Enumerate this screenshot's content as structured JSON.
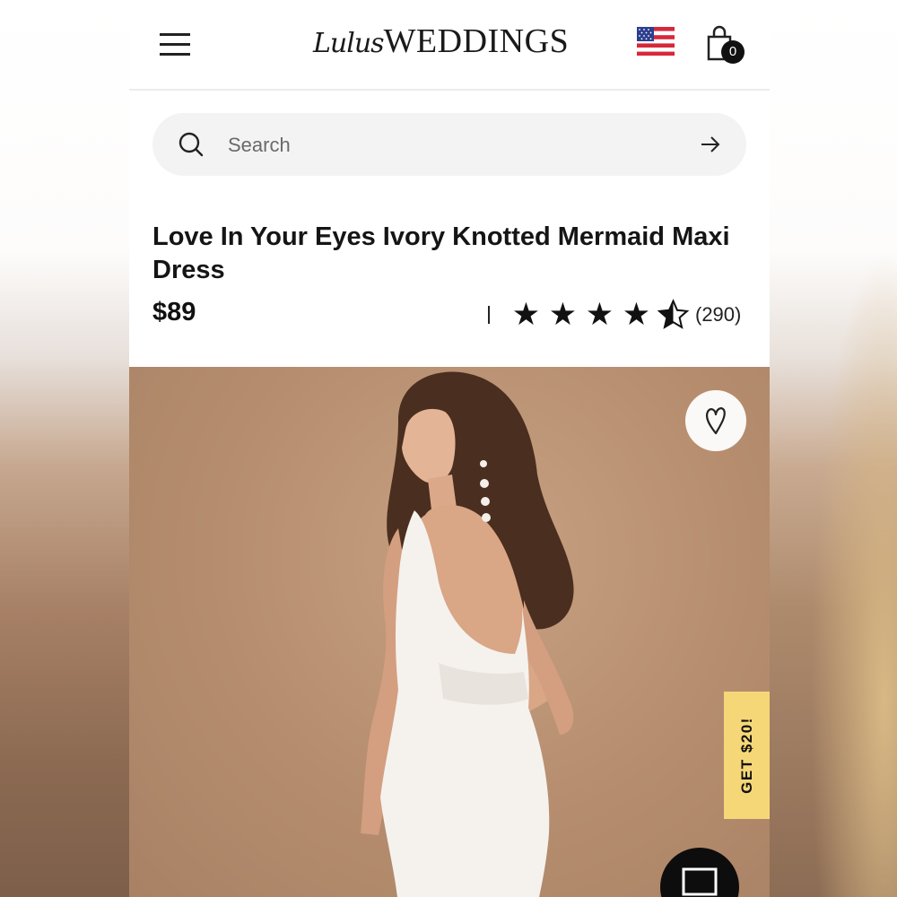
{
  "header": {
    "menu_icon": "hamburger-menu-icon",
    "logo_script": "Lulus",
    "logo_main": "WEDDINGS",
    "flag_icon": "us-flag-icon",
    "cart_icon": "shopping-bag-icon",
    "cart_count": "0"
  },
  "search": {
    "placeholder": "Search",
    "icon": "search-icon",
    "submit_icon": "arrow-right-icon"
  },
  "product": {
    "title": "Love In Your Eyes Ivory Knotted Mermaid Maxi Dress",
    "price": "$89",
    "rating": {
      "value": 4.5,
      "max": 5,
      "stars": [
        "★",
        "★",
        "★",
        "★",
        "★"
      ],
      "review_count": "(290)"
    }
  },
  "image": {
    "favorite_icon": "heart-icon",
    "promo_label": "GET $20!",
    "chat_icon": "chat-icon"
  },
  "colors": {
    "background": "#ffffff",
    "search_bg": "#f3f3f3",
    "text": "#151515",
    "promo_bg": "#f6d778",
    "image_bg": "#b58d6e"
  }
}
